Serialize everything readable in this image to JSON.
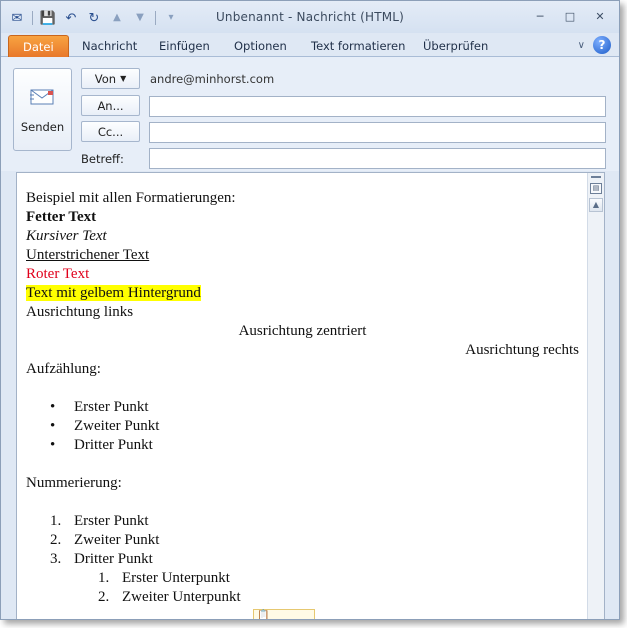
{
  "window": {
    "title": "Unbenannt  -  Nachricht (HTML)"
  },
  "qat": {
    "icons": [
      "mail-icon",
      "save-icon",
      "undo-icon",
      "redo-icon",
      "up-icon",
      "down-icon",
      "customize-icon"
    ]
  },
  "tabs": [
    {
      "label": "Datei"
    },
    {
      "label": "Nachricht"
    },
    {
      "label": "Einfügen"
    },
    {
      "label": "Optionen"
    },
    {
      "label": "Text formatieren"
    },
    {
      "label": "Überprüfen"
    }
  ],
  "header": {
    "send_label": "Senden",
    "from_button": "Von",
    "from_value": "andre@minhorst.com",
    "to_button": "An...",
    "cc_button": "Cc...",
    "subject_label": "Betreff:",
    "to_value": "",
    "cc_value": "",
    "subject_value": ""
  },
  "body": {
    "intro": "Beispiel mit allen Formatierungen:",
    "bold": "Fetter Text",
    "italic": "Kursiver Text",
    "underline": "Unterstrichener Text",
    "red": "Roter Text",
    "highlight": "Text mit gelbem Hintergrund",
    "align_left": "Ausrichtung links",
    "align_center": "Ausrichtung zentriert",
    "align_right": "Ausrichtung rechts",
    "bullets_heading": "Aufzählung:",
    "bullets": [
      "Erster Punkt",
      "Zweiter Punkt",
      "Dritter Punkt"
    ],
    "numbering_heading": "Nummerierung:",
    "numbered": [
      {
        "num": "1.",
        "text": "Erster Punkt"
      },
      {
        "num": "2.",
        "text": "Zweiter Punkt"
      },
      {
        "num": "3.",
        "text": "Dritter Punkt"
      }
    ],
    "sub_numbered": [
      {
        "num": "1.",
        "text": "Erster Unterpunkt"
      },
      {
        "num": "2.",
        "text": "Zweiter Unterpunkt"
      }
    ]
  },
  "colors": {
    "file_tab": "#e8782b",
    "red_text": "#e0001b",
    "highlight": "#ffff00"
  }
}
